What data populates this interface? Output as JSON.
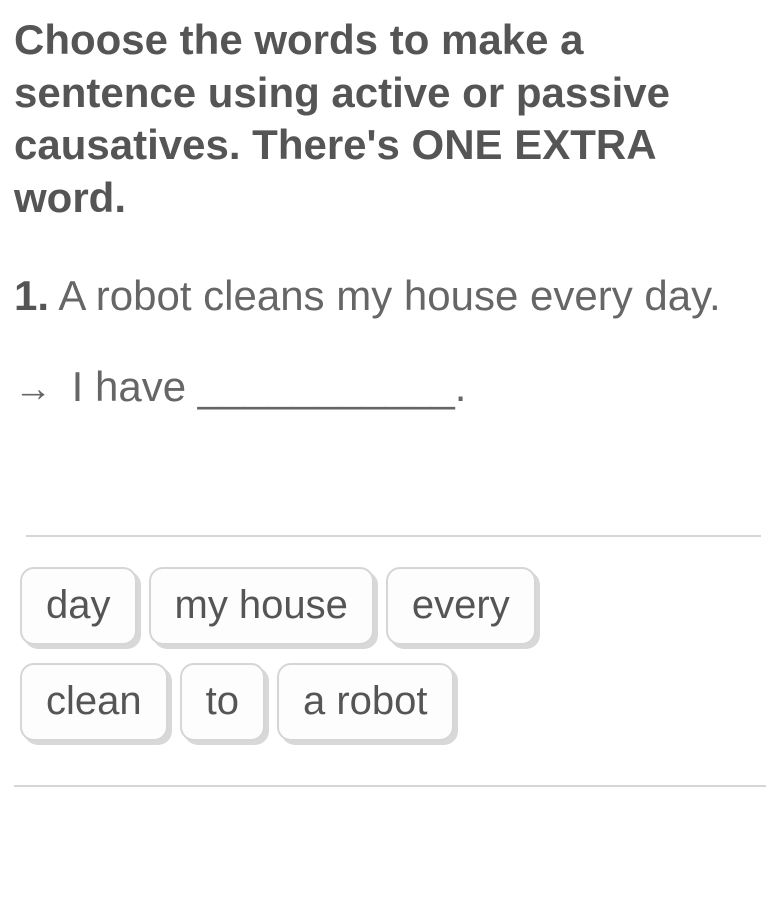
{
  "instructions": "Choose the words to make a sentence using active or passive causatives. There's ONE EXTRA word.",
  "question": {
    "number": "1.",
    "text": "A robot cleans my house every day."
  },
  "answer": {
    "arrow": "→",
    "prefix": "I have",
    "blank": "___________",
    "suffix": "."
  },
  "tiles": {
    "row1": [
      "day",
      "my house",
      "every"
    ],
    "row2": [
      "clean",
      "to",
      "a robot"
    ]
  }
}
